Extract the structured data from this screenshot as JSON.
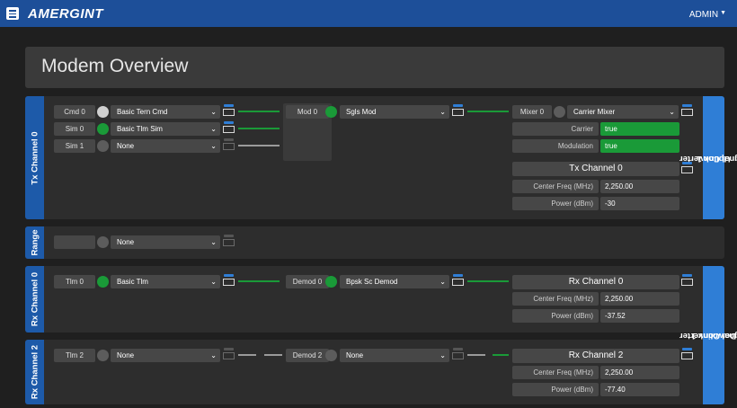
{
  "app": {
    "logo": "AMERGINT",
    "user": "ADMIN"
  },
  "page": {
    "title": "Modem Overview"
  },
  "colors": {
    "brand_blue": "#1d4f99",
    "label_blue": "#1d5aa9",
    "converter_blue": "#2f7ed6",
    "active_green": "#1a9a38"
  },
  "tx0": {
    "label": "Tx Channel 0",
    "cmd0": {
      "name": "Cmd 0",
      "value": "Basic Tern Cmd"
    },
    "sim0": {
      "name": "Sim 0",
      "value": "Basic Tlm Sim"
    },
    "sim1": {
      "name": "Sim 1",
      "value": "None"
    },
    "mod0": {
      "name": "Mod 0",
      "value": "Sgls Mod"
    },
    "mixer0": {
      "name": "Mixer 0",
      "value": "Carrier Mixer"
    },
    "carrier": {
      "label": "Carrier",
      "value": "true"
    },
    "modulation": {
      "label": "Modulation",
      "value": "true"
    },
    "channel": {
      "title": "Tx Channel 0",
      "freq_label": "Center Freq (MHz)",
      "freq": "2,250.00",
      "power_label": "Power (dBm)",
      "power": "-30"
    }
  },
  "uplink": {
    "label_line1": "Signal Converter",
    "label_line2": "Uplink 1"
  },
  "range": {
    "label": "Range",
    "value": "None"
  },
  "rx0": {
    "label": "Rx Channel 0",
    "tlm": {
      "name": "Tlm 0",
      "value": "Basic Tlm"
    },
    "demod": {
      "name": "Demod 0",
      "value": "Bpsk Sc Demod"
    },
    "channel": {
      "title": "Rx Channel 0",
      "freq_label": "Center Freq (MHz)",
      "freq": "2,250.00",
      "power_label": "Power (dBm)",
      "power": "-37.52"
    }
  },
  "downlink": {
    "label_line1": "Signal Converter",
    "label_line2": "Downlink 1"
  },
  "rx2": {
    "label": "Rx Channel 2",
    "tlm": {
      "name": "Tlm 2",
      "value": "None"
    },
    "demod": {
      "name": "Demod 2",
      "value": "None"
    },
    "channel": {
      "title": "Rx Channel 2",
      "freq_label": "Center Freq (MHz)",
      "freq": "2,250.00",
      "power_label": "Power (dBm)",
      "power": "-77.40"
    }
  }
}
